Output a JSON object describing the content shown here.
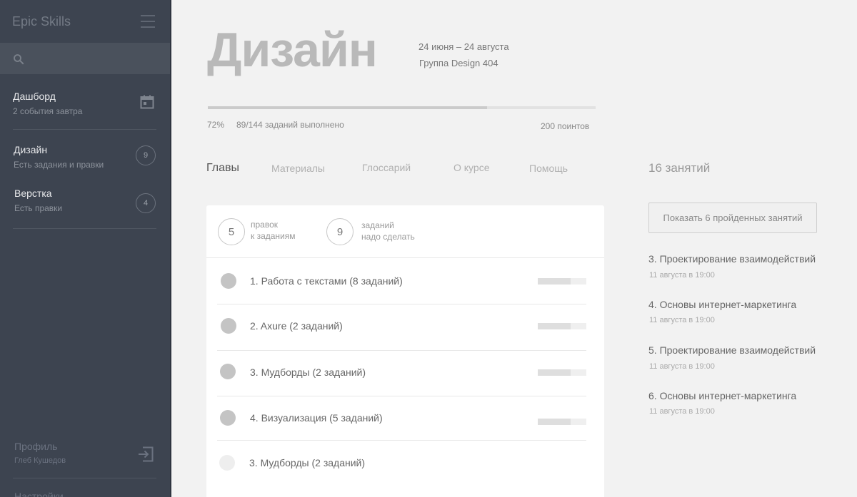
{
  "sidebar": {
    "brand": "Epic Skills",
    "search_placeholder": "",
    "items": [
      {
        "title": "Дашборд",
        "subtitle": "2 события завтра"
      },
      {
        "title": "Дизайн",
        "subtitle": "Есть задания и правки",
        "badge": "9"
      },
      {
        "title": "Верстка",
        "subtitle": "Есть правки",
        "badge": "4"
      }
    ],
    "profile": {
      "title": "Профиль",
      "name": "Глеб Кушедов"
    },
    "settings": "Настройки"
  },
  "course": {
    "title": "Дизайн",
    "dates": "24 июня – 24 августа",
    "group": "Группа Design 404",
    "progress_percent_label": "72%",
    "progress_fraction": 0.72,
    "tasks_done": "89/144 заданий выполнено",
    "points": "200 поинтов"
  },
  "tabs": [
    {
      "label": "Главы",
      "active": true
    },
    {
      "label": "Материалы"
    },
    {
      "label": "Глоссарий"
    },
    {
      "label": "О курсе"
    },
    {
      "label": "Помощь"
    }
  ],
  "stats": [
    {
      "value": "5",
      "line1": "правок",
      "line2": "к заданиям"
    },
    {
      "value": "9",
      "line1": "заданий",
      "line2": "надо сделать"
    }
  ],
  "chapters": [
    {
      "label": "1. Работа с текстами (8 заданий)",
      "progress": 0.68
    },
    {
      "label": "2. Axure (2 заданий)",
      "progress": 0.68
    },
    {
      "label": "3. Мудборды (2 заданий)",
      "progress": 0.68
    },
    {
      "label": "4. Визуализация (5 заданий)",
      "progress": 0.68
    },
    {
      "label": "3. Мудборды (2 заданий)",
      "progress": 0
    }
  ],
  "lessons": {
    "count_label": "16 занятий",
    "show_completed": "Показать 6 пройденных занятий",
    "items": [
      {
        "title": "3. Проектирование взаимодействий",
        "time": "11 августа в 19:00"
      },
      {
        "title": "4. Основы интернет-маркетинга",
        "time": "11 августа в 19:00"
      },
      {
        "title": "5. Проектирование взаимодействий",
        "time": "11 августа в 19:00"
      },
      {
        "title": "6. Основы интернет-маркетинга",
        "time": "11 августа в 19:00"
      }
    ]
  }
}
